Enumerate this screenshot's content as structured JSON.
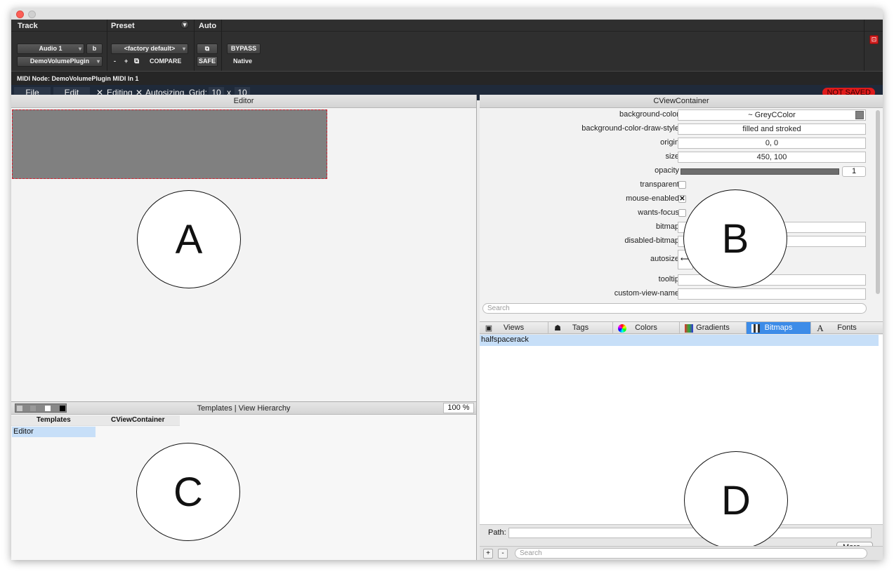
{
  "header": {
    "track_label": "Track",
    "preset_label": "Preset",
    "auto_label": "Auto",
    "track_name": "Audio 1",
    "track_variant": "b",
    "plugin_name": "DemoVolumePlugin",
    "preset_value": "<factory default>",
    "minus": "-",
    "plus": "+",
    "compare": "COMPARE",
    "bypass": "BYPASS",
    "safe": "SAFE",
    "native": "Native",
    "midi_node": "MIDI Node: DemoVolumePlugin MIDI In 1"
  },
  "toolbar": {
    "file": "File",
    "edit": "Edit",
    "editing_mark": "✕",
    "editing": "Editing",
    "autosizing_mark": "✕",
    "autosizing": "Autosizing",
    "grid_label": "Grid:",
    "grid_x": "10",
    "grid_sep": "x",
    "grid_y": "10",
    "status": "NOT SAVED"
  },
  "editor": {
    "title": "Editor",
    "marker": "A"
  },
  "templates": {
    "title": "Templates | View Hierarchy",
    "zoom": "100 %",
    "col1": "Templates",
    "col2": "CViewContainer",
    "item": "Editor",
    "marker": "C"
  },
  "inspector": {
    "title": "CViewContainer",
    "marker": "B",
    "search_placeholder": "Search",
    "rows": {
      "background_color": {
        "label": "background-color",
        "value": "~ GreyCColor"
      },
      "draw_style": {
        "label": "background-color-draw-style",
        "value": "filled and stroked"
      },
      "origin": {
        "label": "origin",
        "value": "0, 0"
      },
      "size": {
        "label": "size",
        "value": "450, 100"
      },
      "opacity": {
        "label": "opacity",
        "value": "1"
      },
      "transparent": {
        "label": "transparent"
      },
      "mouse_enabled": {
        "label": "mouse-enabled",
        "mark": "✕"
      },
      "wants_focus": {
        "label": "wants-focus"
      },
      "bitmap": {
        "label": "bitmap"
      },
      "disabled_bitmap": {
        "label": "disabled-bitmap"
      },
      "autosize": {
        "label": "autosize"
      },
      "tooltip": {
        "label": "tooltip"
      },
      "custom_view_name": {
        "label": "custom-view-name"
      }
    }
  },
  "resources": {
    "marker": "D",
    "tabs": [
      "Views",
      "Tags",
      "Colors",
      "Gradients",
      "Bitmaps",
      "Fonts"
    ],
    "active_tab": "Bitmaps",
    "item": "halfspacerack",
    "path_label": "Path:",
    "more": "More...",
    "add": "+",
    "remove": "-",
    "search_placeholder": "Search"
  },
  "colors": {
    "accent": "#3d8ce8",
    "not_saved": "#e01b1b",
    "view_bg": "#808080"
  }
}
